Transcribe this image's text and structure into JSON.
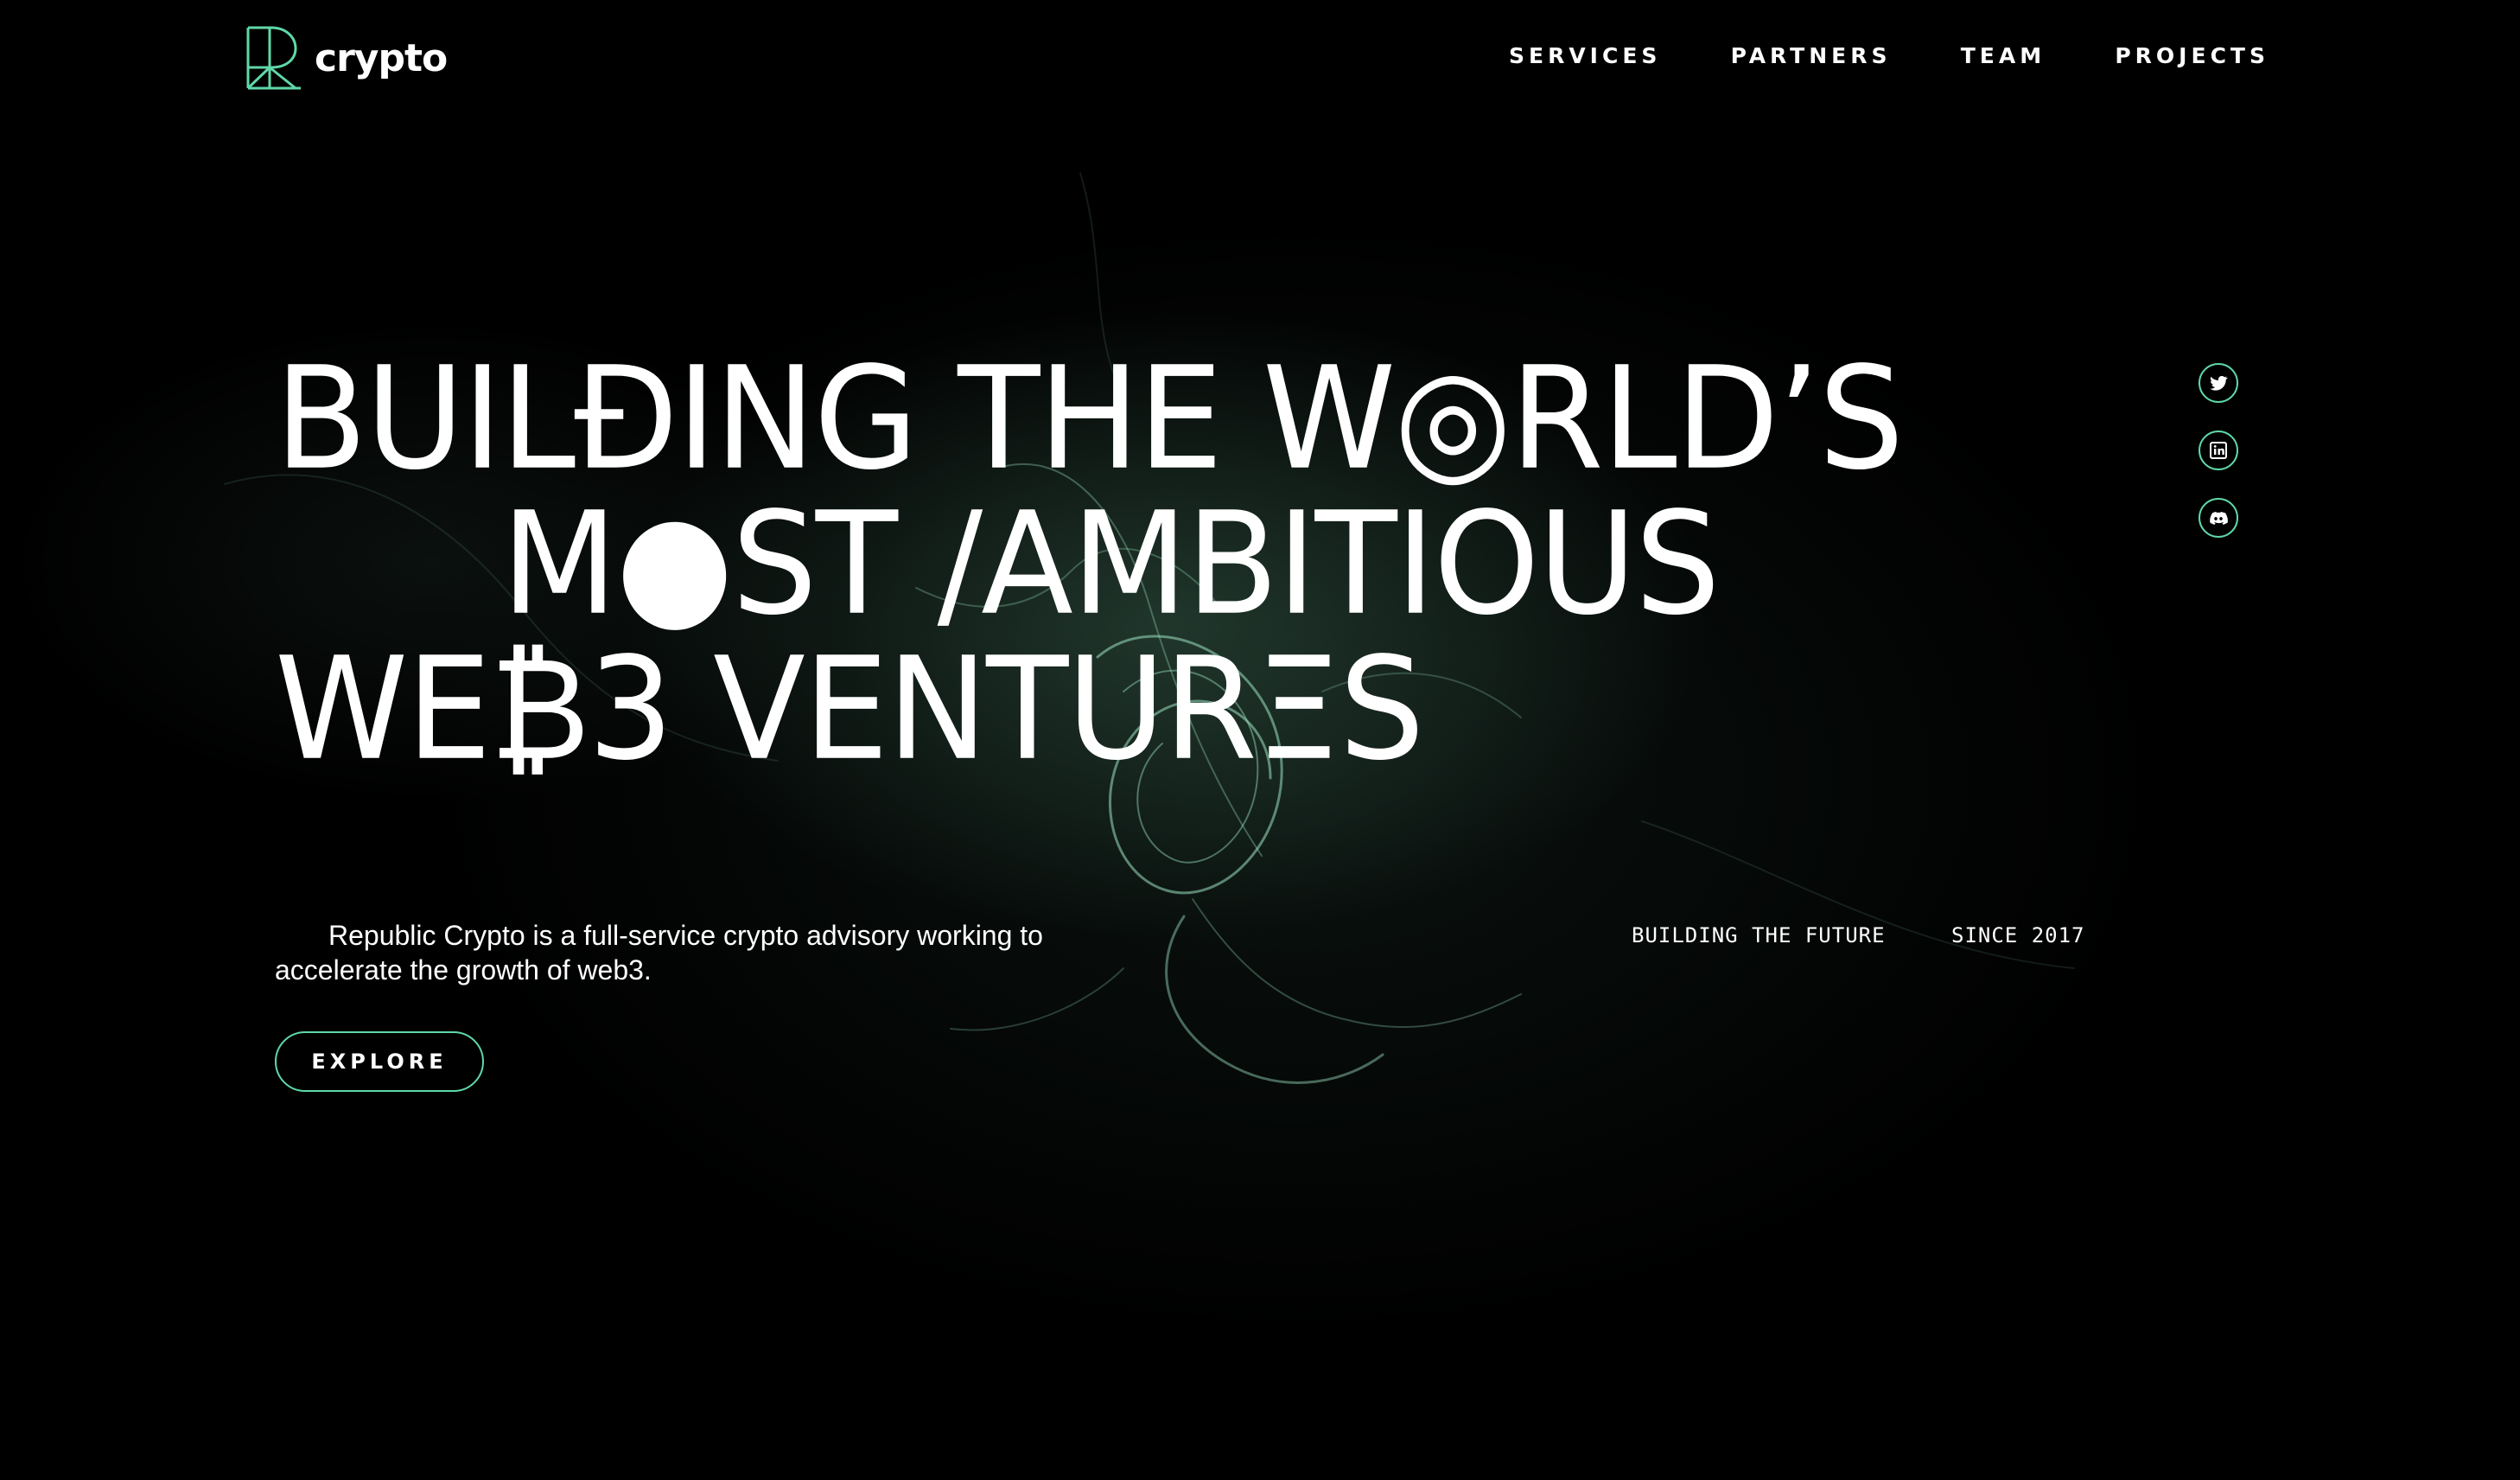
{
  "brand": {
    "name": "crypto",
    "logo_icon": "r-monogram-logo-icon",
    "accent_color": "#5fd8a8"
  },
  "nav": {
    "items": [
      {
        "label": "SERVICES"
      },
      {
        "label": "PARTNERS"
      },
      {
        "label": "TEAM"
      },
      {
        "label": "PROJECTS"
      }
    ]
  },
  "hero": {
    "line1": "BUILÐING THE W◎RLD’S",
    "line2": "M●ST ∕AMBITIOUS",
    "line3": "WE₿3 VENTURΞS"
  },
  "intro": {
    "text": "Republic Crypto is a full-service crypto advisory working to accelerate the growth of web3."
  },
  "taglines": {
    "left": "BUILDING THE FUTURE",
    "right": "SINCE 2017"
  },
  "cta": {
    "explore_label": "EXPLORE"
  },
  "social": [
    {
      "icon": "twitter-icon"
    },
    {
      "icon": "linkedin-icon"
    },
    {
      "icon": "discord-icon"
    }
  ],
  "colors": {
    "background": "#000000",
    "text": "#ffffff",
    "accent": "#5fd8a8"
  }
}
